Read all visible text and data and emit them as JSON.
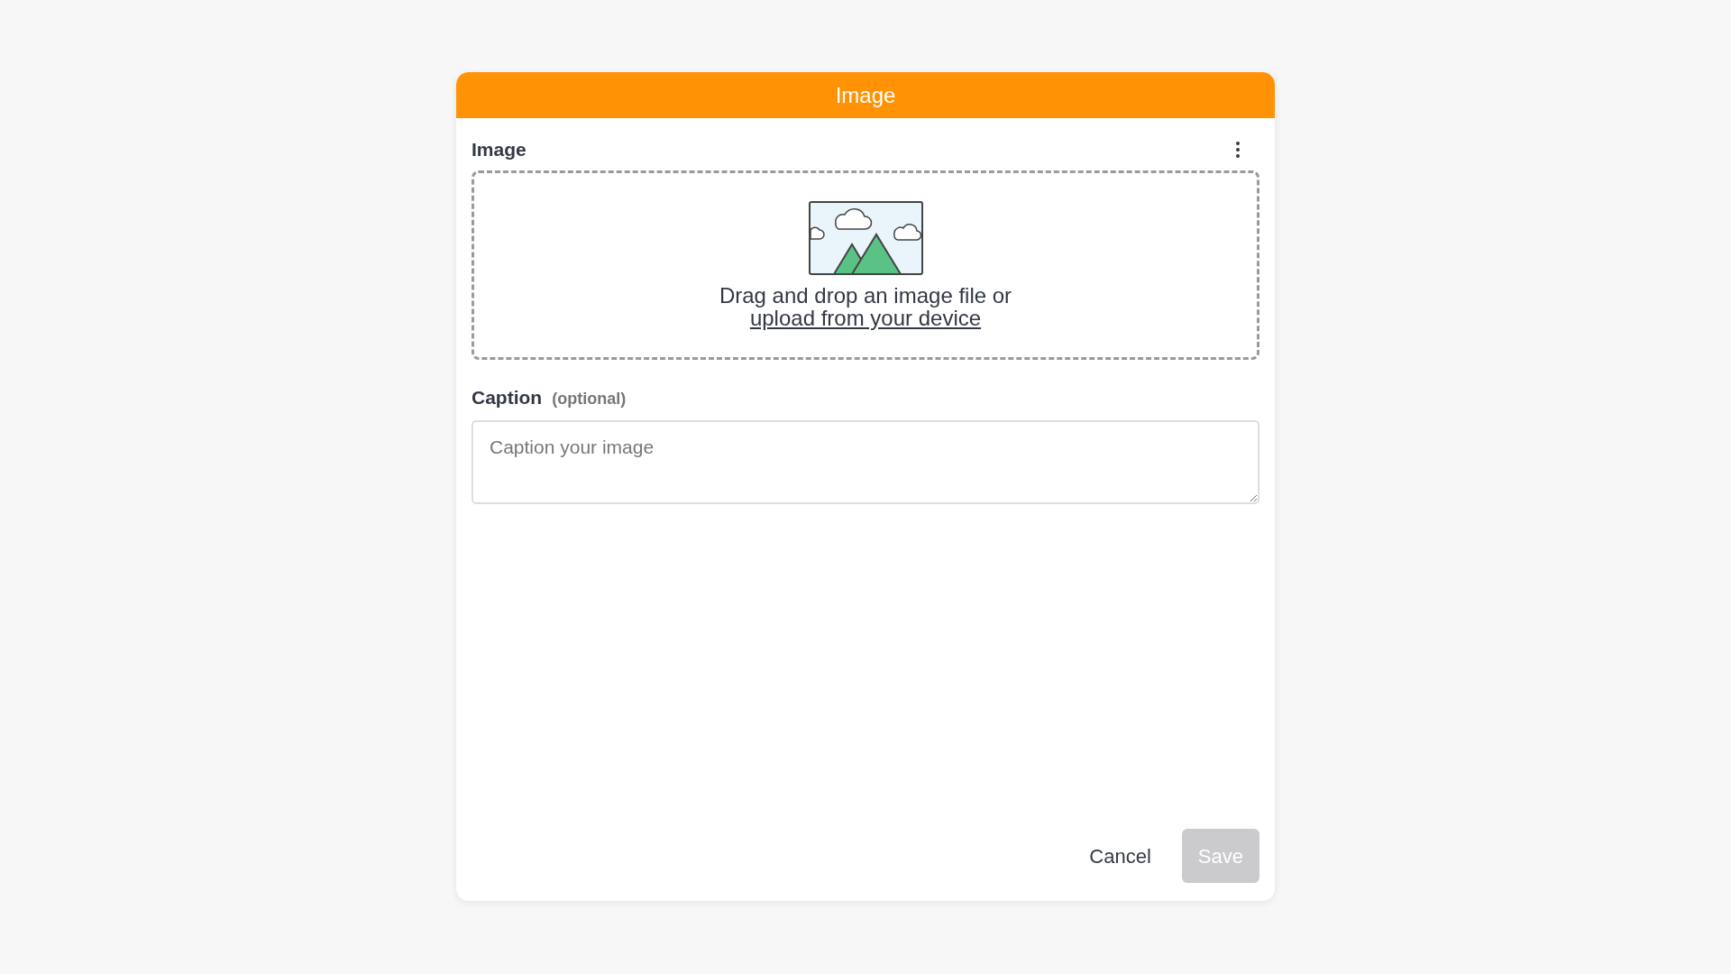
{
  "dialog": {
    "title": "Image"
  },
  "image_field": {
    "label": "Image",
    "dropzone_text": "Drag and drop an image file or",
    "upload_link": "upload from your device"
  },
  "caption_field": {
    "label": "Caption",
    "hint": "(optional)",
    "placeholder": "Caption your image"
  },
  "buttons": [
    {
      "label": "Cancel",
      "kind": "secondary",
      "disabled": false
    },
    {
      "label": "Save",
      "kind": "primary",
      "disabled": true
    }
  ]
}
